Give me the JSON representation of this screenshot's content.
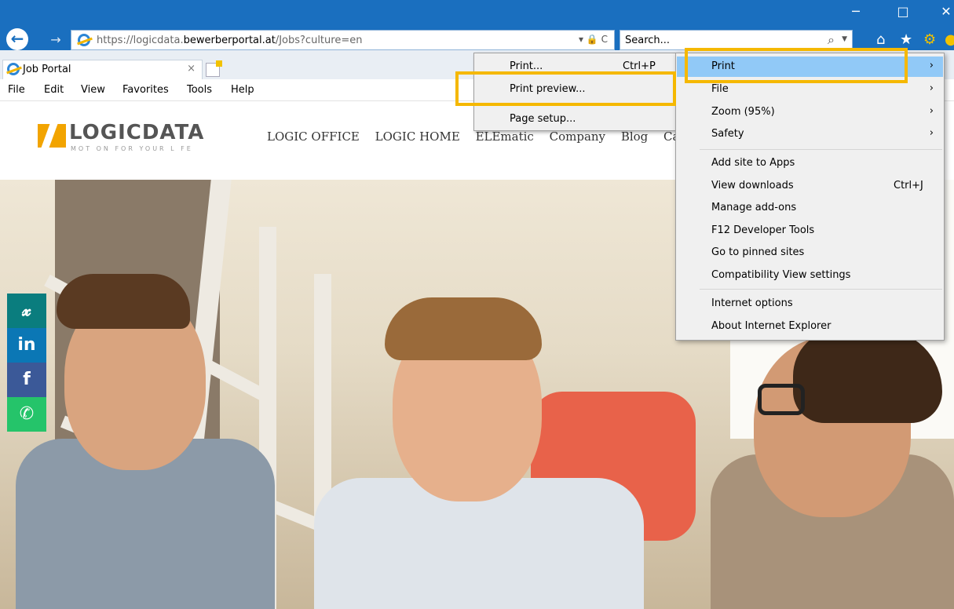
{
  "window": {
    "minimize_glyph": "─",
    "maximize_glyph": "□",
    "close_glyph": "✕"
  },
  "addressbar": {
    "url_scheme": "https://logicdata.",
    "url_domain": "bewerberportal.at",
    "url_path": "/Jobs?culture=en",
    "icons": "▾ 🔒 C"
  },
  "search": {
    "placeholder": "Search..."
  },
  "toolbar_icons": [
    "home-icon",
    "star-icon",
    "gear-icon",
    "smiley-icon"
  ],
  "tab": {
    "title": "Job Portal",
    "close": "×"
  },
  "menubar": {
    "items": [
      "File",
      "Edit",
      "View",
      "Favorites",
      "Tools",
      "Help"
    ]
  },
  "site": {
    "logo_text": "LOGICDATA",
    "tagline": "MOT ON FOR YOUR L FE",
    "nav": [
      "LOGIC OFFICE",
      "LOGIC HOME",
      "ELEmatic",
      "Company",
      "Blog",
      "Ca"
    ]
  },
  "social": [
    {
      "icon": "xing-icon",
      "glyph": "𝔁",
      "color": "#0a7d7e"
    },
    {
      "icon": "linkedin-icon",
      "glyph": "in",
      "color": "#0b77b5"
    },
    {
      "icon": "facebook-icon",
      "glyph": "f",
      "color": "#3b5998"
    },
    {
      "icon": "whatsapp-icon",
      "glyph": "✆",
      "color": "#25c46a"
    }
  ],
  "print_submenu": [
    {
      "label": "Print...",
      "shortcut": "Ctrl+P"
    },
    {
      "label": "Print preview...",
      "shortcut": ""
    },
    {
      "label": "Page setup...",
      "shortcut": ""
    }
  ],
  "tools_menu": {
    "group1": [
      {
        "label": "Print",
        "arrow": "›",
        "highlighted": true
      },
      {
        "label": "File",
        "arrow": "›"
      },
      {
        "label": "Zoom (95%)",
        "arrow": "›"
      },
      {
        "label": "Safety",
        "arrow": "›"
      }
    ],
    "group2": [
      {
        "label": "Add site to Apps",
        "shortcut": ""
      },
      {
        "label": "View downloads",
        "shortcut": "Ctrl+J"
      },
      {
        "label": "Manage add-ons",
        "shortcut": ""
      },
      {
        "label": "F12 Developer Tools",
        "shortcut": ""
      },
      {
        "label": "Go to pinned sites",
        "shortcut": ""
      },
      {
        "label": "Compatibility View settings",
        "shortcut": ""
      }
    ],
    "group3": [
      {
        "label": "Internet options",
        "shortcut": ""
      },
      {
        "label": "About Internet Explorer",
        "shortcut": ""
      }
    ]
  },
  "colors": {
    "chrome_blue": "#1a6fbf",
    "menu_highlight": "#91c9f7",
    "callout": "#f5b800",
    "logo_orange": "#f2a400"
  }
}
